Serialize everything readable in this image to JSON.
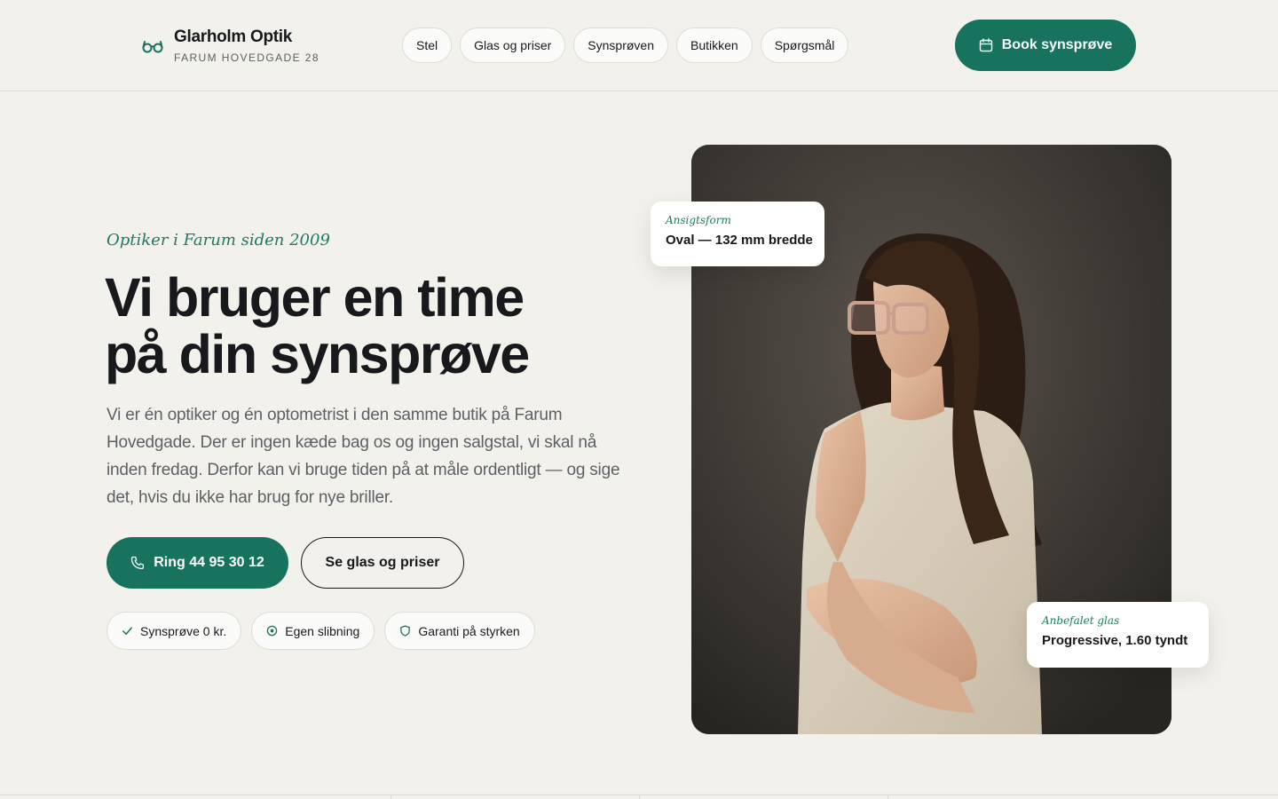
{
  "brand": {
    "name": "Glarholm Optik",
    "address": "FARUM HOVEDGADE 28",
    "icon": "glasses-icon"
  },
  "nav": {
    "items": [
      {
        "label": "Stel"
      },
      {
        "label": "Glas og priser"
      },
      {
        "label": "Synsprøven"
      },
      {
        "label": "Butikken"
      },
      {
        "label": "Spørgsmål"
      }
    ],
    "book_label": "Book synsprøve",
    "book_icon": "calendar-icon"
  },
  "hero": {
    "eyebrow": "Optiker i Farum siden 2009",
    "headline_line1": "Vi bruger en time",
    "headline_line2": "på din synsprøve",
    "lead": "Vi er én optiker og én optometrist i den samme butik på Farum Hovedgade. Der er ingen kæde bag os og ingen salgstal, vi skal nå inden fredag. Derfor kan vi bruge tiden på at måle ordentligt — og sige det, hvis du ikke har brug for nye briller.",
    "call_label": "Ring 44 95 30 12",
    "call_icon": "phone-icon",
    "secondary_label": "Se glas og priser",
    "badges": [
      {
        "label": "Synsprøve 0 kr.",
        "icon": "check-icon"
      },
      {
        "label": "Egen slibning",
        "icon": "target-icon"
      },
      {
        "label": "Garanti på styrken",
        "icon": "shield-icon"
      }
    ]
  },
  "cards": {
    "face": {
      "label": "Ansigtsform",
      "value": "Oval — 132 mm bredde"
    },
    "lens": {
      "label": "Anbefalet glas",
      "value": "Progressive, 1.60 tyndt"
    }
  },
  "colors": {
    "accent": "#17735e",
    "accent_text": "#1d7a63",
    "background": "#f2f1ec",
    "ink": "#17191c"
  }
}
